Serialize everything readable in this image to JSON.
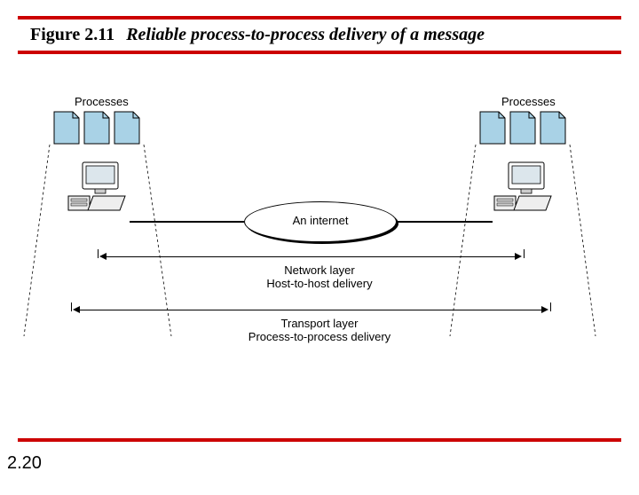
{
  "header": {
    "figure_number": "Figure 2.11",
    "figure_title": "Reliable process-to-process delivery of a message"
  },
  "diagram": {
    "left_label": "Processes",
    "right_label": "Processes",
    "internet_label": "An internet",
    "network_layer_line1": "Network layer",
    "network_layer_line2": "Host-to-host delivery",
    "transport_layer_line1": "Transport layer",
    "transport_layer_line2": "Process-to-process delivery"
  },
  "footer": {
    "slide_number": "2.20"
  }
}
